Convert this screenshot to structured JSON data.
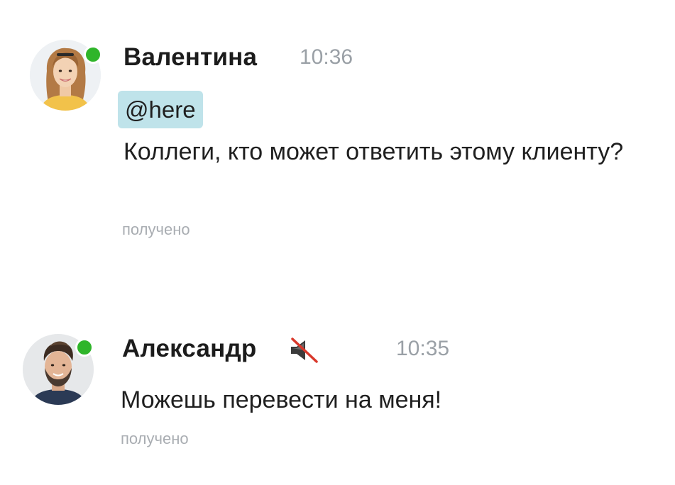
{
  "messages": [
    {
      "sender": "Валентина",
      "time": "10:36",
      "online": true,
      "mention": "@here",
      "text": "Коллеги, кто может ответить этому клиенту?",
      "status": "получено",
      "avatar_icon": "avatar-woman-icon"
    },
    {
      "sender": "Александр",
      "time": "10:35",
      "online": true,
      "muted_icon": "muted-speaker-icon",
      "text": "Можешь перевести на меня!",
      "status": "получено",
      "avatar_icon": "avatar-man-icon"
    }
  ],
  "colors": {
    "presence": "#2fb52a",
    "mention_bg": "#bfe3ea",
    "meta_text": "#9aa0a6",
    "mute_strike": "#d9382b"
  }
}
